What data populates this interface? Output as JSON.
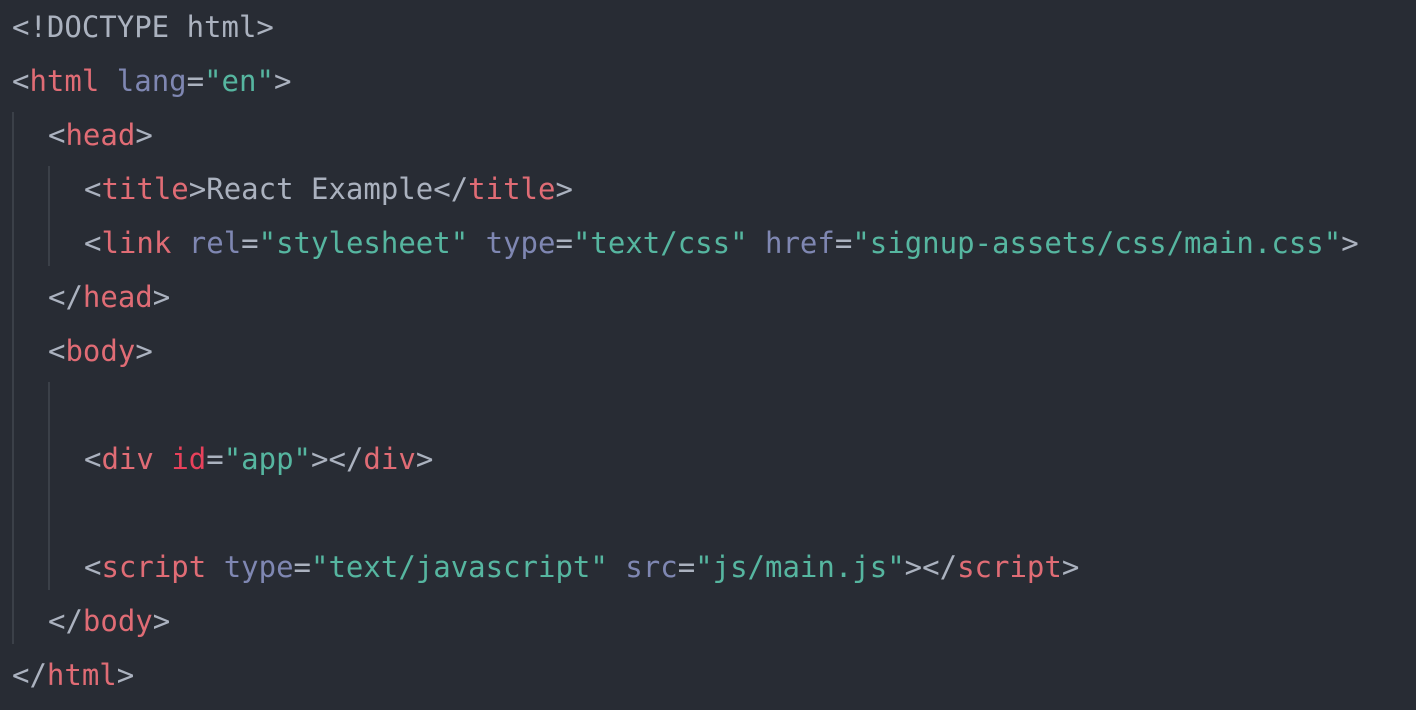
{
  "editor": {
    "theme_colors": {
      "background": "#282c34",
      "punctuation": "#abb2bf",
      "tag": "#e06c75",
      "attribute": "#7f87b2",
      "id_attribute": "#e8415b",
      "string": "#56b6a0",
      "text": "#abb2bf",
      "indent_guide": "#3b4048"
    },
    "lines": [
      {
        "indent": 0,
        "tokens": [
          {
            "t": "doctype",
            "v": "<!DOCTYPE html>"
          }
        ]
      },
      {
        "indent": 0,
        "tokens": [
          {
            "t": "punct",
            "v": "<"
          },
          {
            "t": "tag",
            "v": "html"
          },
          {
            "t": "text",
            "v": " "
          },
          {
            "t": "attr",
            "v": "lang"
          },
          {
            "t": "punct",
            "v": "="
          },
          {
            "t": "str",
            "v": "\"en\""
          },
          {
            "t": "punct",
            "v": ">"
          }
        ]
      },
      {
        "indent": 1,
        "tokens": [
          {
            "t": "punct",
            "v": "<"
          },
          {
            "t": "tag",
            "v": "head"
          },
          {
            "t": "punct",
            "v": ">"
          }
        ]
      },
      {
        "indent": 2,
        "tokens": [
          {
            "t": "punct",
            "v": "<"
          },
          {
            "t": "tag",
            "v": "title"
          },
          {
            "t": "punct",
            "v": ">"
          },
          {
            "t": "text",
            "v": "React Example"
          },
          {
            "t": "punct",
            "v": "</"
          },
          {
            "t": "tag",
            "v": "title"
          },
          {
            "t": "punct",
            "v": ">"
          }
        ]
      },
      {
        "indent": 2,
        "tokens": [
          {
            "t": "punct",
            "v": "<"
          },
          {
            "t": "tag",
            "v": "link"
          },
          {
            "t": "text",
            "v": " "
          },
          {
            "t": "attr",
            "v": "rel"
          },
          {
            "t": "punct",
            "v": "="
          },
          {
            "t": "str",
            "v": "\"stylesheet\""
          },
          {
            "t": "text",
            "v": " "
          },
          {
            "t": "attr",
            "v": "type"
          },
          {
            "t": "punct",
            "v": "="
          },
          {
            "t": "str",
            "v": "\"text/css\""
          },
          {
            "t": "text",
            "v": " "
          },
          {
            "t": "attr",
            "v": "href"
          },
          {
            "t": "punct",
            "v": "="
          },
          {
            "t": "str",
            "v": "\"signup-assets/css/main.css\""
          },
          {
            "t": "punct",
            "v": ">"
          }
        ]
      },
      {
        "indent": 1,
        "tokens": [
          {
            "t": "punct",
            "v": "</"
          },
          {
            "t": "tag",
            "v": "head"
          },
          {
            "t": "punct",
            "v": ">"
          }
        ]
      },
      {
        "indent": 1,
        "tokens": [
          {
            "t": "punct",
            "v": "<"
          },
          {
            "t": "tag",
            "v": "body"
          },
          {
            "t": "punct",
            "v": ">"
          }
        ]
      },
      {
        "indent": 2,
        "tokens": []
      },
      {
        "indent": 2,
        "tokens": [
          {
            "t": "punct",
            "v": "<"
          },
          {
            "t": "tag",
            "v": "div"
          },
          {
            "t": "text",
            "v": " "
          },
          {
            "t": "id",
            "v": "id"
          },
          {
            "t": "punct",
            "v": "="
          },
          {
            "t": "str",
            "v": "\"app\""
          },
          {
            "t": "punct",
            "v": "></"
          },
          {
            "t": "tag",
            "v": "div"
          },
          {
            "t": "punct",
            "v": ">"
          }
        ]
      },
      {
        "indent": 2,
        "tokens": []
      },
      {
        "indent": 2,
        "tokens": [
          {
            "t": "punct",
            "v": "<"
          },
          {
            "t": "tag",
            "v": "script"
          },
          {
            "t": "text",
            "v": " "
          },
          {
            "t": "attr",
            "v": "type"
          },
          {
            "t": "punct",
            "v": "="
          },
          {
            "t": "str",
            "v": "\"text/javascript\""
          },
          {
            "t": "text",
            "v": " "
          },
          {
            "t": "attr",
            "v": "src"
          },
          {
            "t": "punct",
            "v": "="
          },
          {
            "t": "str",
            "v": "\"js/main.js\""
          },
          {
            "t": "punct",
            "v": "></"
          },
          {
            "t": "tag",
            "v": "script"
          },
          {
            "t": "punct",
            "v": ">"
          }
        ]
      },
      {
        "indent": 1,
        "tokens": [
          {
            "t": "punct",
            "v": "</"
          },
          {
            "t": "tag",
            "v": "body"
          },
          {
            "t": "punct",
            "v": ">"
          }
        ]
      },
      {
        "indent": 0,
        "tokens": [
          {
            "t": "punct",
            "v": "</"
          },
          {
            "t": "tag",
            "v": "html"
          },
          {
            "t": "punct",
            "v": ">"
          }
        ]
      }
    ]
  }
}
